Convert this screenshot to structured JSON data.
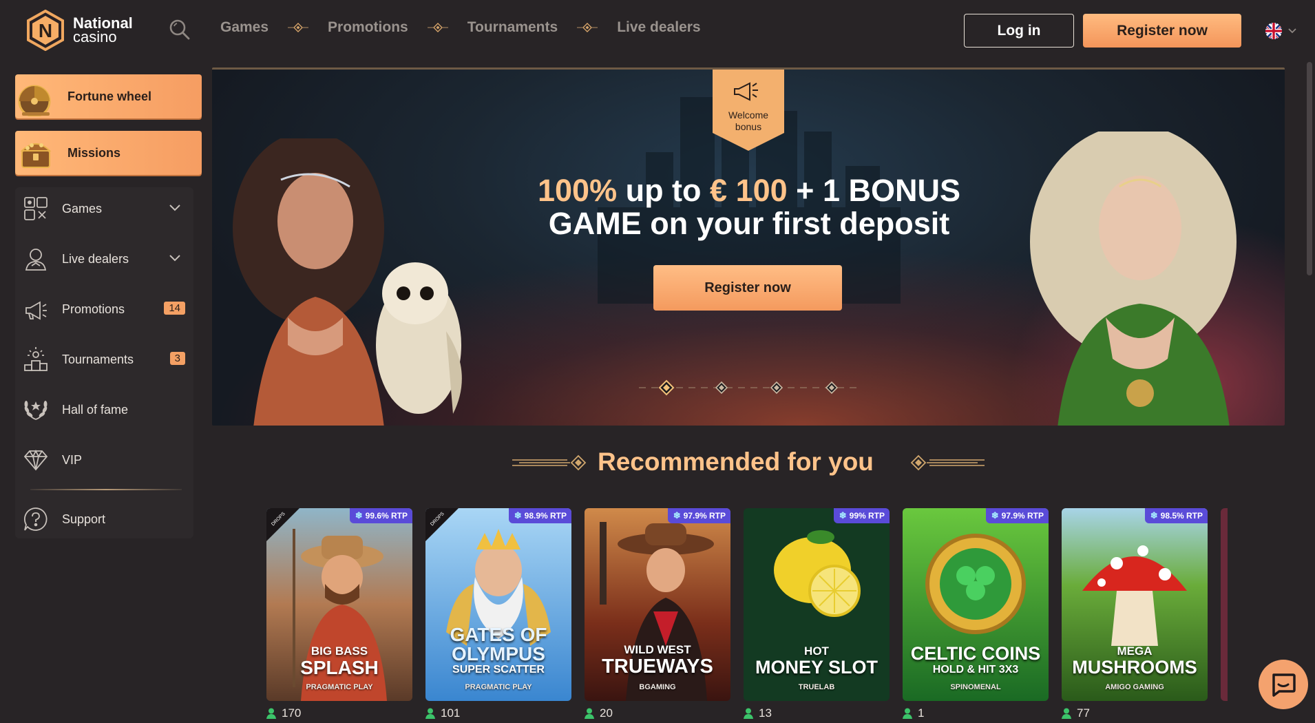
{
  "brand": {
    "name_line1": "National",
    "name_line2": "casino",
    "logo_letter": "N"
  },
  "topnav": {
    "items": [
      "Games",
      "Promotions",
      "Tournaments",
      "Live dealers"
    ]
  },
  "auth": {
    "login": "Log in",
    "register": "Register now"
  },
  "language": {
    "flag": "uk-flag-icon"
  },
  "sidebar": {
    "promos": [
      {
        "label": "Fortune wheel",
        "icon": "fortune-wheel-icon"
      },
      {
        "label": "Missions",
        "icon": "treasure-chest-icon"
      }
    ],
    "items": [
      {
        "label": "Games",
        "icon": "games-icon",
        "expandable": true
      },
      {
        "label": "Live dealers",
        "icon": "live-dealer-icon",
        "expandable": true
      },
      {
        "label": "Promotions",
        "icon": "megaphone-icon",
        "badge": "14"
      },
      {
        "label": "Tournaments",
        "icon": "trophy-icon",
        "badge": "3"
      },
      {
        "label": "Hall of fame",
        "icon": "laurel-icon"
      },
      {
        "label": "VIP",
        "icon": "diamond-icon"
      },
      {
        "label": "Support",
        "icon": "question-icon"
      }
    ]
  },
  "banner": {
    "tag_line1": "Welcome",
    "tag_line2": "bonus",
    "headline_a": "100%",
    "headline_b": " up to ",
    "headline_c": "€ 100",
    "headline_d": " + 1 BONUS",
    "headline_e": "GAME on your first deposit",
    "cta": "Register now",
    "slides_active": 1
  },
  "recommended": {
    "title": "Recommended for you",
    "games": [
      {
        "line1": "BIG BASS",
        "line2": "SPLASH",
        "provider": "PRAGMATIC PLAY",
        "rtp": "99.6% RTP",
        "players": "170",
        "drops": "DROPS & WINS",
        "bg1": "#7b5a44",
        "bg2": "#c97c4c"
      },
      {
        "line1": "GATES OF",
        "line2": "OLYMPUS",
        "line3": "SUPER SCATTER",
        "provider": "PRAGMATIC PLAY",
        "rtp": "98.9% RTP",
        "players": "101",
        "drops": "DROPS & WINS",
        "bg1": "#7fb6e8",
        "bg2": "#3d8fd6"
      },
      {
        "line1": "WILD WEST",
        "line2": "TRUEWAYS",
        "provider": "BGAMING",
        "rtp": "97.9% RTP",
        "players": "20",
        "bg1": "#a04a2a",
        "bg2": "#4a1e14"
      },
      {
        "line1": "HOT",
        "line2": "MONEY SLOT",
        "provider": "TRUELAB",
        "rtp": "99% RTP",
        "players": "13",
        "bg1": "#143e24",
        "bg2": "#0c2416"
      },
      {
        "line1": "CELTIC COINS",
        "line2": "HOLD & HIT 3X3",
        "provider": "SPINOMENAL",
        "rtp": "97.9% RTP",
        "players": "1",
        "bg1": "#5bbb3a",
        "bg2": "#1e7a2a"
      },
      {
        "line1": "MEGA",
        "line2": "MUSHROOMS",
        "provider": "AMIGO GAMING",
        "rtp": "98.5% RTP",
        "players": "77",
        "bg1": "#6aa83a",
        "bg2": "#2f6a1e"
      }
    ]
  },
  "colors": {
    "accent": "#f4a064",
    "gold": "#ffc38a",
    "bg": "#282426",
    "rtp_badge": "#5a4bd8"
  }
}
